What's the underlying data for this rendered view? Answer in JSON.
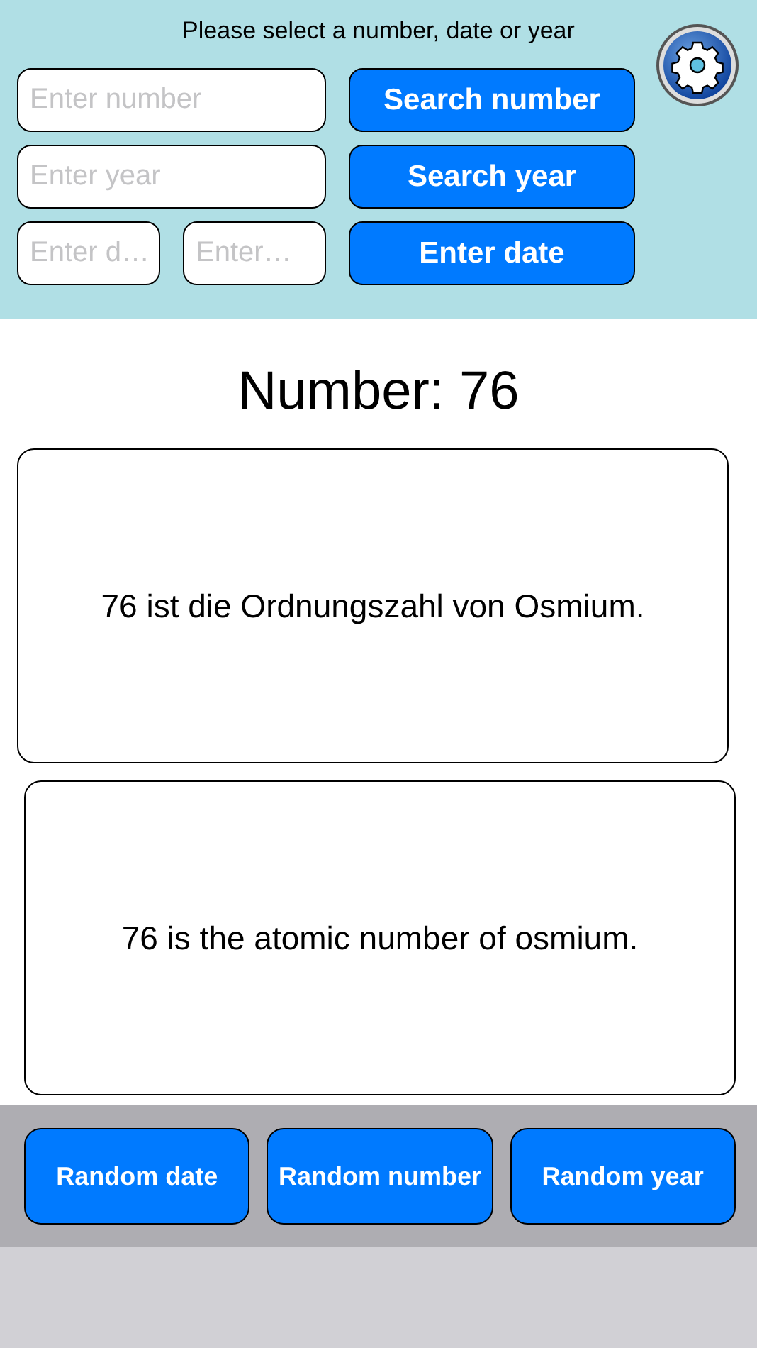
{
  "prompt": "Please select a number, date or year",
  "settings_button": {
    "kind": "gear"
  },
  "search_rows": [
    {
      "fields": [
        {
          "placeholder": "Enter number"
        }
      ],
      "button": "Search number"
    },
    {
      "fields": [
        {
          "placeholder": "Enter year"
        }
      ],
      "button": "Search year"
    },
    {
      "fields": [
        {
          "placeholder": "Enter d…"
        },
        {
          "placeholder": "Enter…"
        }
      ],
      "button": "Enter date"
    }
  ],
  "result_title": "Number: 76",
  "facts": [
    "76 ist die Ordnungszahl von Osmium.",
    "76 is the atomic number of osmium."
  ],
  "random_buttons": [
    "Random date",
    "Random number",
    "Random year"
  ]
}
